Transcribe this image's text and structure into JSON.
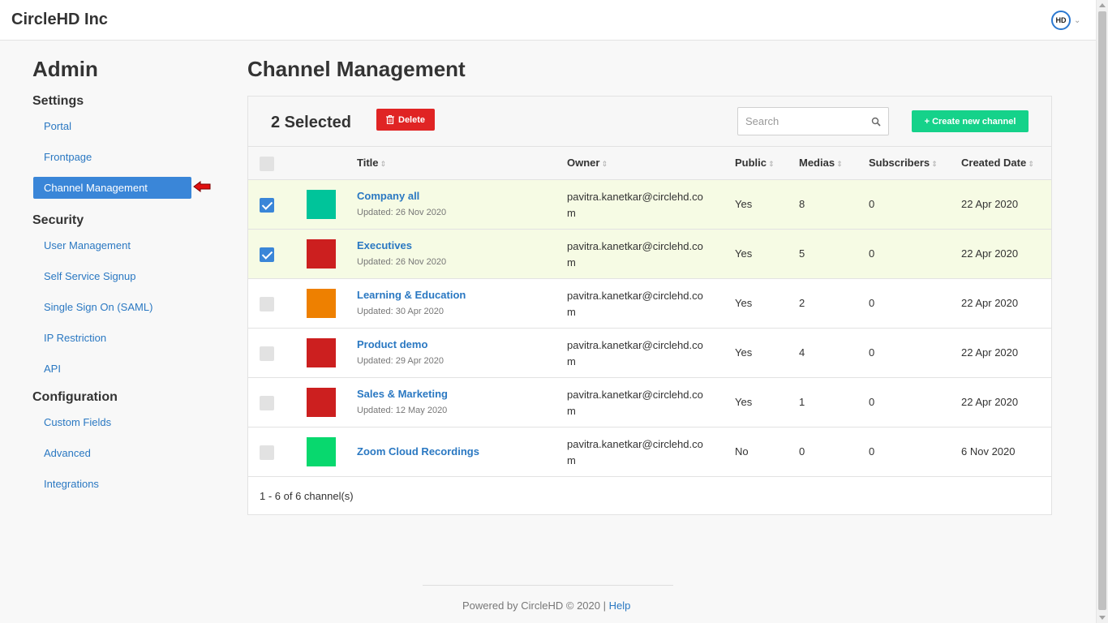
{
  "app": {
    "brand": "CircleHD Inc",
    "avatar_text": "HD"
  },
  "sidebar": {
    "title": "Admin",
    "sections": [
      {
        "title": "Settings",
        "items": [
          "Portal",
          "Frontpage",
          "Channel Management"
        ]
      },
      {
        "title": "Security",
        "items": [
          "User Management",
          "Self Service Signup",
          "Single Sign On (SAML)",
          "IP Restriction",
          "API"
        ]
      },
      {
        "title": "Configuration",
        "items": [
          "Custom Fields",
          "Advanced",
          "Integrations"
        ]
      }
    ],
    "active_item": "Channel Management"
  },
  "main": {
    "title": "Channel Management",
    "selected_label": "2 Selected",
    "delete_label": "Delete",
    "search_placeholder": "Search",
    "create_label": "+ Create new channel",
    "columns": {
      "title": "Title",
      "owner": "Owner",
      "public": "Public",
      "medias": "Medias",
      "subscribers": "Subscribers",
      "created": "Created Date"
    },
    "rows": [
      {
        "title": "Company all",
        "updated": "Updated: 26 Nov 2020",
        "owner": "pavitra.kanetkar@circlehd.com",
        "public": "Yes",
        "medias": "8",
        "subscribers": "0",
        "created": "22 Apr 2020",
        "checked": true,
        "color": "#00c49a"
      },
      {
        "title": "Executives",
        "updated": "Updated: 26 Nov 2020",
        "owner": "pavitra.kanetkar@circlehd.com",
        "public": "Yes",
        "medias": "5",
        "subscribers": "0",
        "created": "22 Apr 2020",
        "checked": true,
        "color": "#cc1f1f"
      },
      {
        "title": "Learning & Education",
        "updated": "Updated: 30 Apr 2020",
        "owner": "pavitra.kanetkar@circlehd.com",
        "public": "Yes",
        "medias": "2",
        "subscribers": "0",
        "created": "22 Apr 2020",
        "checked": false,
        "color": "#ee8000"
      },
      {
        "title": "Product demo",
        "updated": "Updated: 29 Apr 2020",
        "owner": "pavitra.kanetkar@circlehd.com",
        "public": "Yes",
        "medias": "4",
        "subscribers": "0",
        "created": "22 Apr 2020",
        "checked": false,
        "color": "#cc1f1f"
      },
      {
        "title": "Sales & Marketing",
        "updated": "Updated: 12 May 2020",
        "owner": "pavitra.kanetkar@circlehd.com",
        "public": "Yes",
        "medias": "1",
        "subscribers": "0",
        "created": "22 Apr 2020",
        "checked": false,
        "color": "#cc1f1f"
      },
      {
        "title": "Zoom Cloud Recordings",
        "updated": "",
        "owner": "pavitra.kanetkar@circlehd.com",
        "public": "No",
        "medias": "0",
        "subscribers": "0",
        "created": "6 Nov 2020",
        "checked": false,
        "color": "#08d86e"
      }
    ],
    "pager": "1 - 6 of 6 channel(s)"
  },
  "footer": {
    "text": "Powered by CircleHD © 2020 |",
    "help": "Help"
  },
  "colors": {
    "accent": "#3a86d8",
    "link": "#2a78c2",
    "danger": "#e02424",
    "success": "#15d28a",
    "selected_row": "#f6fbe4"
  }
}
